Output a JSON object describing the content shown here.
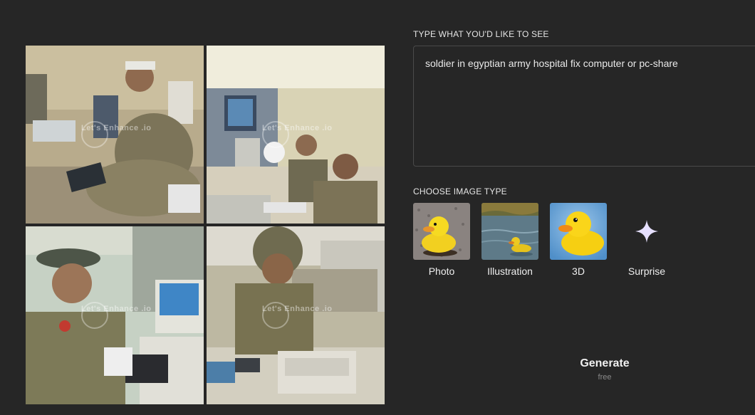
{
  "watermark": {
    "text": "Let's Enhance .io"
  },
  "prompt": {
    "label": "TYPE WHAT YOU'D LIKE TO SEE",
    "value": "soldier in egyptian army hospital fix computer or pc-share"
  },
  "image_type": {
    "label": "CHOOSE IMAGE TYPE",
    "options": [
      {
        "label": "Photo",
        "icon": "rubber-duck-on-gravel-thumbnail"
      },
      {
        "label": "Illustration",
        "icon": "duck-on-water-thumbnail"
      },
      {
        "label": "3D",
        "icon": "3d-rubber-duck-thumbnail"
      },
      {
        "label": "Surprise",
        "icon": "sparkle-icon"
      }
    ]
  },
  "generate": {
    "label": "Generate",
    "sub": "free"
  },
  "colors": {
    "background": "#262626",
    "border": "#4a4a4a",
    "sparkle": "#e6e0ff"
  }
}
